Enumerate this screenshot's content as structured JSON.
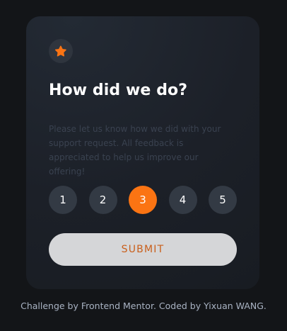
{
  "card": {
    "icon": "star-icon",
    "title": "How did we do?",
    "description": "Please let us know how we did with your support request. All feedback is appreciated to help us improve our offering!",
    "ratings": [
      "1",
      "2",
      "3",
      "4",
      "5"
    ],
    "selected_rating": "3",
    "submit_label": "SUBMIT"
  },
  "footer": {
    "credit": "Challenge by Frontend Mentor. Coded by Yixuan WANG."
  },
  "colors": {
    "accent": "#fb7413",
    "background": "#131518",
    "card": "#1c2028",
    "rating_button": "#333a44"
  }
}
